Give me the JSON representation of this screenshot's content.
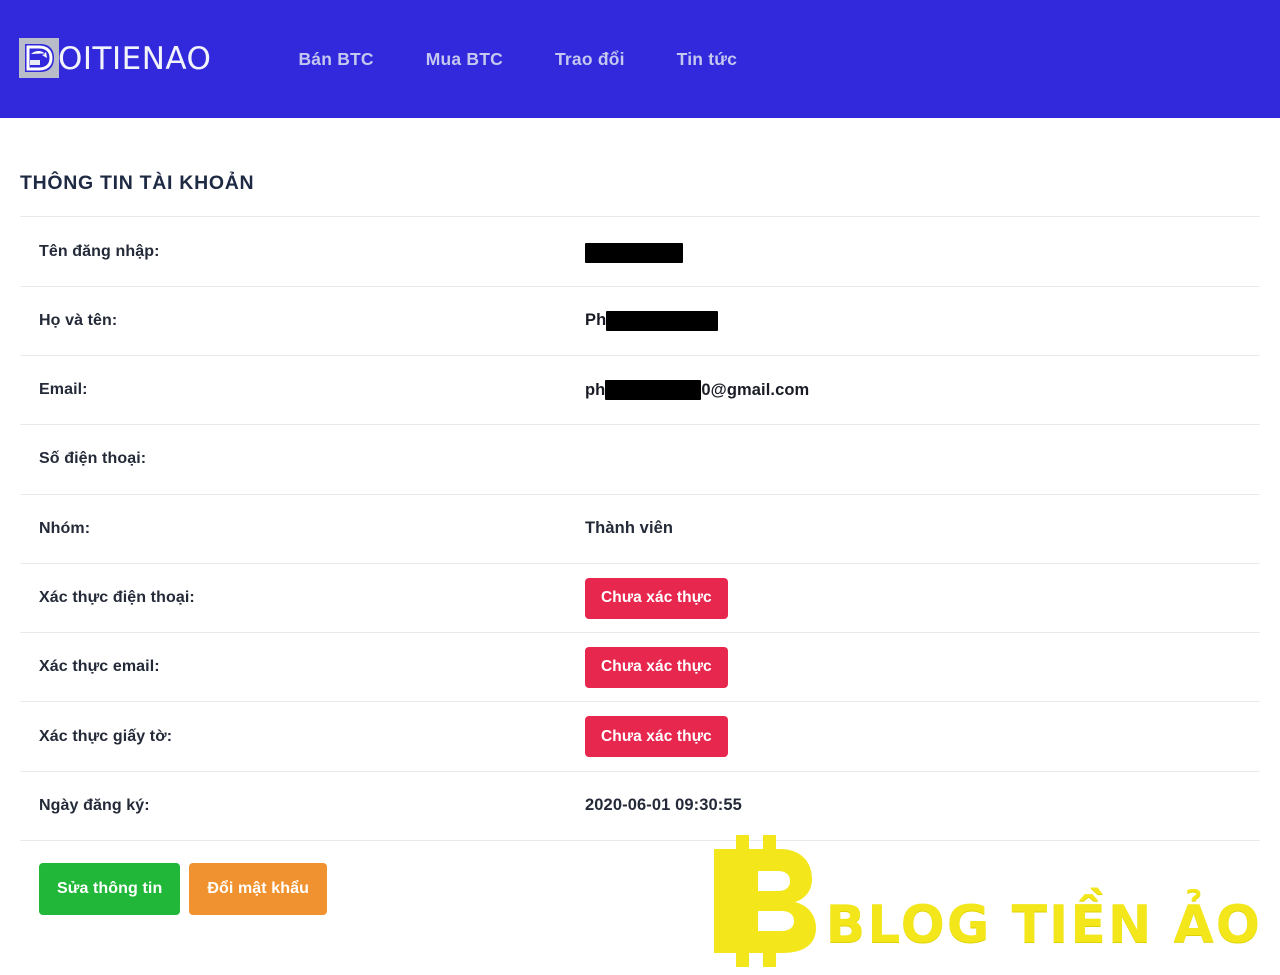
{
  "theme": {
    "header_bg": "#3129db",
    "nav_link_color": "#c4c7ef",
    "title_color": "#1e2a44",
    "danger": "#e8274f",
    "success": "#21b839",
    "warning": "#f0922f",
    "watermark_yellow": "#f3e71c",
    "divider": "#e9eaee"
  },
  "header": {
    "logo_icon": "doitienao-d-mark-icon",
    "brand": "OITIENAO",
    "brand_full": "DOITIENAO",
    "nav": [
      {
        "label": "Bán BTC",
        "name": "nav-ban-btc"
      },
      {
        "label": "Mua BTC",
        "name": "nav-mua-btc"
      },
      {
        "label": "Trao đổi",
        "name": "nav-trao-doi"
      },
      {
        "label": "Tin tức",
        "name": "nav-tin-tuc"
      }
    ]
  },
  "page": {
    "title": "THÔNG TIN TÀI KHOẢN"
  },
  "account": {
    "rows": [
      {
        "label": "Tên đăng nhập:",
        "value": "",
        "type": "redacted"
      },
      {
        "label": "Họ và tên:",
        "value": "Ph",
        "type": "redacted-prefix"
      },
      {
        "label": "Email:",
        "prefix": "ph",
        "suffix": "0@gmail.com",
        "type": "redacted-email"
      },
      {
        "label": "Số điện thoại:",
        "value": "",
        "type": "text"
      },
      {
        "label": "Nhóm:",
        "value": "Thành viên",
        "type": "text"
      },
      {
        "label": "Xác thực điện thoại:",
        "value": "Chưa xác thực",
        "type": "status"
      },
      {
        "label": "Xác thực email:",
        "value": "Chưa xác thực",
        "type": "status"
      },
      {
        "label": "Xác thực giấy tờ:",
        "value": "Chưa xác thực",
        "type": "status"
      },
      {
        "label": "Ngày đăng ký:",
        "value": "2020-06-01 09:30:55",
        "type": "text"
      }
    ]
  },
  "actions": {
    "edit_label": "Sửa thông tin",
    "password_label": "Đổi mật khẩu"
  },
  "watermark": {
    "icon": "bitcoin-b-icon",
    "text": "BLOG TIỀN ẢO"
  }
}
